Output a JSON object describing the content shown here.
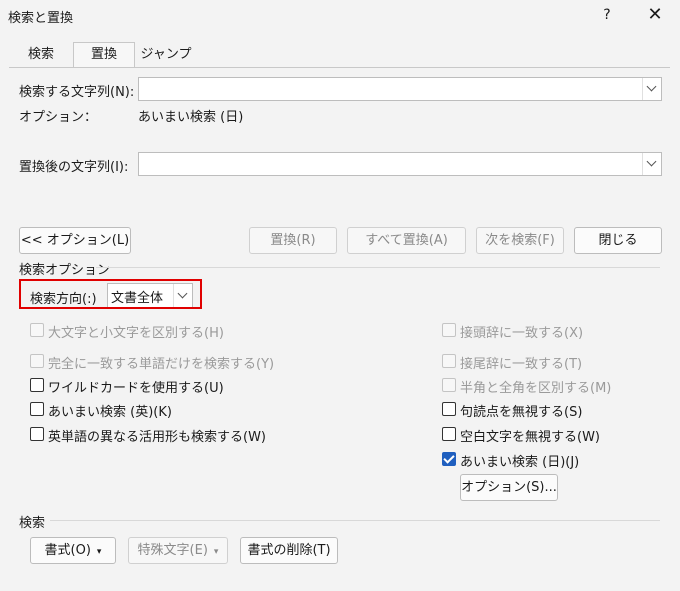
{
  "window": {
    "title": "検索と置換",
    "help": "?",
    "close": "✕"
  },
  "tabs": [
    {
      "label": "検索"
    },
    {
      "label": "置換"
    },
    {
      "label": "ジャンプ"
    }
  ],
  "find": {
    "label": "検索する文字列(N):",
    "value": ""
  },
  "options_line": {
    "label": "オプション：",
    "value": "あいまい検索 (日)"
  },
  "replace": {
    "label": "置換後の文字列(I):",
    "value": ""
  },
  "buttons": {
    "options": "<< オプション(L)",
    "replace": "置換(R)",
    "replace_all": "すべて置換(A)",
    "find_next": "次を検索(F)",
    "close": "閉じる"
  },
  "search_options": {
    "header": "検索オプション",
    "direction_label": "検索方向(:)",
    "direction_value": "文書全体",
    "left": [
      {
        "label": "大文字と小文字を区別する(H)",
        "checked": false,
        "disabled": true
      },
      {
        "label": "完全に一致する単語だけを検索する(Y)",
        "checked": false,
        "disabled": true
      },
      {
        "label": "ワイルドカードを使用する(U)",
        "checked": false,
        "disabled": false
      },
      {
        "label": "あいまい検索 (英)(K)",
        "checked": false,
        "disabled": false
      },
      {
        "label": "英単語の異なる活用形も検索する(W)",
        "checked": false,
        "disabled": false
      }
    ],
    "right": [
      {
        "label": "接頭辞に一致する(X)",
        "checked": false,
        "disabled": true
      },
      {
        "label": "接尾辞に一致する(T)",
        "checked": false,
        "disabled": true
      },
      {
        "label": "半角と全角を区別する(M)",
        "checked": false,
        "disabled": true
      },
      {
        "label": "句読点を無視する(S)",
        "checked": false,
        "disabled": false
      },
      {
        "label": "空白文字を無視する(W)",
        "checked": false,
        "disabled": false
      },
      {
        "label": "あいまい検索 (日)(J)",
        "checked": true,
        "disabled": false
      }
    ],
    "fuzzy_options_button": "オプション(S)..."
  },
  "search_section": {
    "header": "検索",
    "format": "書式(O)",
    "special": "特殊文字(E)",
    "clear_format": "書式の削除(T)"
  }
}
